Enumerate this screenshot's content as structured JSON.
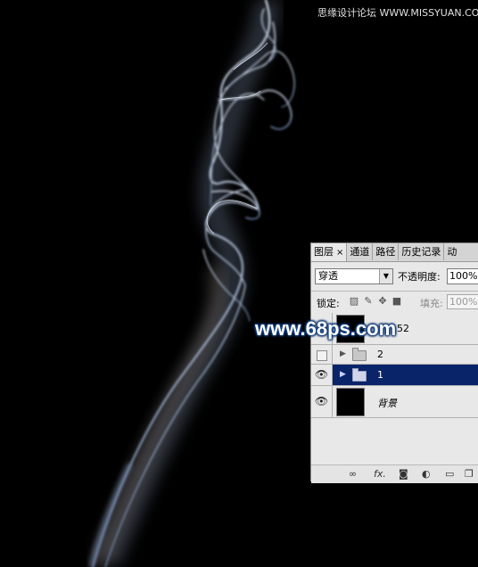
{
  "watermarks": {
    "top": "思缘设计论坛 WWW.MISSYUAN.COM",
    "middle": "www.68ps.com"
  },
  "panel": {
    "tabs": [
      {
        "label": "图层",
        "active": true,
        "closable": true
      },
      {
        "label": "通道",
        "active": false
      },
      {
        "label": "路径",
        "active": false
      },
      {
        "label": "历史记录",
        "active": false
      },
      {
        "label": "动",
        "active": false
      }
    ],
    "close_glyph": "×",
    "blend_mode": "穿透",
    "opacity_label": "不透明度:",
    "opacity_value": "100%",
    "lock_label": "锁定:",
    "lock_icons": [
      "lock-transparent-icon",
      "lock-paint-icon",
      "lock-move-icon",
      "lock-all-icon"
    ],
    "fill_label": "填充:",
    "fill_value": "100%",
    "layers": [
      {
        "name": "52",
        "type": "image",
        "visible": false,
        "selected": false
      },
      {
        "name": "2",
        "type": "group",
        "visible": false,
        "selected": false
      },
      {
        "name": "1",
        "type": "group",
        "visible": true,
        "selected": true
      },
      {
        "name": "背景",
        "type": "image",
        "visible": true,
        "selected": false
      }
    ],
    "bottom_icons": [
      "link-icon",
      "fx-icon",
      "mask-icon",
      "adjustment-icon",
      "folder-icon",
      "new-layer-icon"
    ],
    "fx_label": "fx."
  },
  "colors": {
    "selection": "#0a246a",
    "smoke": "#c9d6ea",
    "background": "#000000"
  }
}
